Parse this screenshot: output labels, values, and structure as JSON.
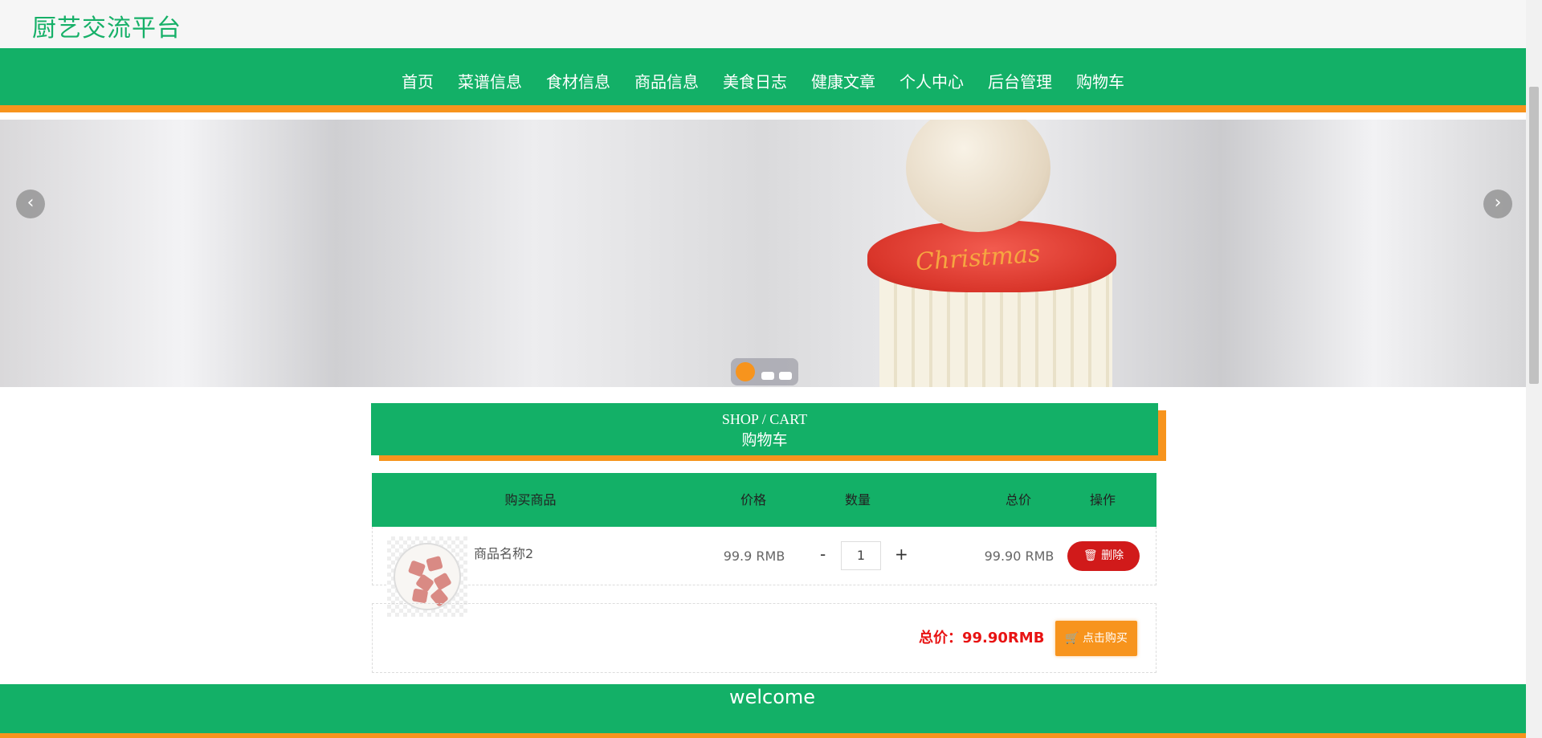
{
  "brand": {
    "title": "厨艺交流平台",
    "color": "#16b068"
  },
  "nav": {
    "items": [
      "首页",
      "菜谱信息",
      "食材信息",
      "商品信息",
      "美食日志",
      "健康文章",
      "个人中心",
      "后台管理",
      "购物车"
    ]
  },
  "banner": {
    "slides": 3,
    "active_slide": 1,
    "prev_icon": "chevron-left-icon",
    "next_icon": "chevron-right-icon"
  },
  "section": {
    "title_en": "SHOP / CART",
    "title_cn": "购物车"
  },
  "cart": {
    "columns": [
      "购买商品",
      "价格",
      "数量",
      "总价",
      "操作"
    ],
    "items": [
      {
        "name": "商品名称2",
        "price": "99.9 RMB",
        "quantity": "1",
        "minus": "-",
        "plus": "+",
        "total": "99.90 RMB",
        "delete_label": "删除"
      }
    ],
    "summary_label": "总价：99.90RMB",
    "buy_label": "点击购买"
  },
  "footer": {
    "text": "welcome"
  },
  "colors": {
    "green": "#13b067",
    "orange": "#f7941d",
    "red": "#d11a1a"
  }
}
